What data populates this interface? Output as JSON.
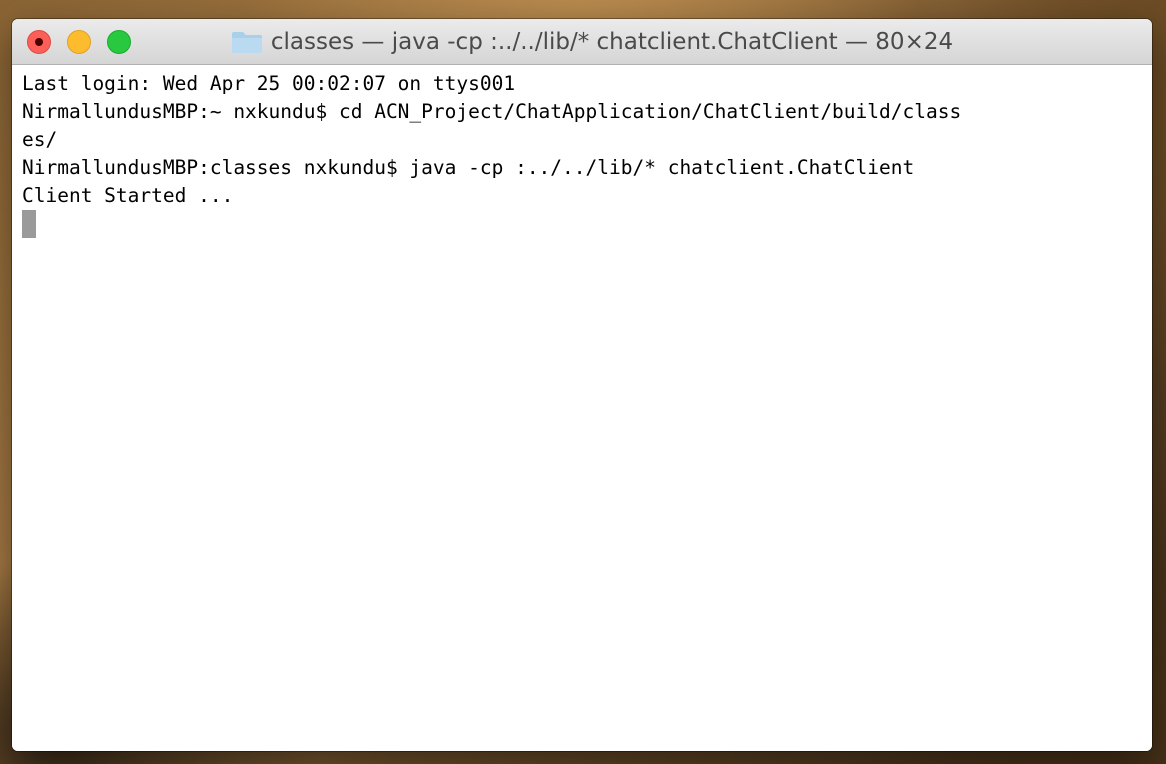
{
  "window": {
    "title": "classes — java -cp :../../lib/* chatclient.ChatClient — 80×24",
    "folder_icon": "folder-icon",
    "buttons": {
      "close": {
        "icon": "close-icon",
        "color": "#fc5f57"
      },
      "minimize": {
        "icon": "minimize-icon",
        "color": "#fdbc2e"
      },
      "zoom": {
        "icon": "zoom-icon",
        "color": "#28c840"
      }
    }
  },
  "terminal": {
    "lines": [
      "Last login: Wed Apr 25 00:02:07 on ttys001",
      "NirmallundusMBP:~ nxkundu$ cd ACN_Project/ChatApplication/ChatClient/build/class",
      "es/",
      "NirmallundusMBP:classes nxkundu$ java -cp :../../lib/* chatclient.ChatClient",
      "Client Started ..."
    ],
    "cursor_color": "#9a9a9a"
  }
}
